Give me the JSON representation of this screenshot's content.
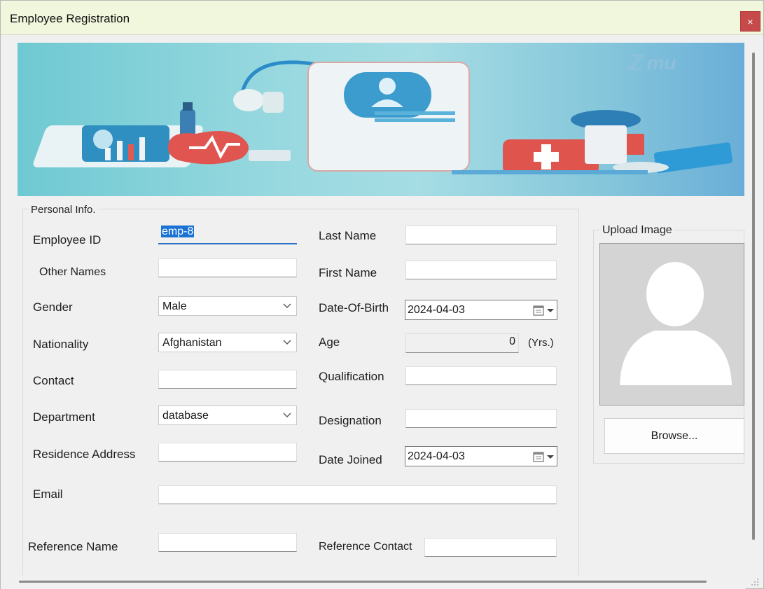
{
  "window": {
    "title": "Employee Registration",
    "close_label": "×"
  },
  "personal": {
    "group_label": "Personal Info.",
    "employee_id_label": "Employee ID",
    "employee_id_value": "emp-8",
    "other_names_label": "Other Names",
    "gender_label": "Gender",
    "gender_value": "Male",
    "nationality_label": "Nationality",
    "nationality_value": "Afghanistan",
    "contact_label": "Contact",
    "department_label": "Department",
    "department_value": "database",
    "residence_label": "Residence Address",
    "email_label": "Email",
    "reference_name_label": "Reference Name",
    "last_name_label": "Last Name",
    "first_name_label": "First Name",
    "dob_label": "Date-Of-Birth",
    "dob_value": "2024-04-03",
    "age_label": "Age",
    "age_value": "0",
    "age_unit": "(Yrs.)",
    "qualification_label": "Qualification",
    "designation_label": "Designation",
    "date_joined_label": "Date Joined",
    "date_joined_value": "2024-04-03",
    "reference_contact_label": "Reference Contact"
  },
  "upload": {
    "group_label": "Upload Image",
    "browse_label": "Browse..."
  },
  "colors": {
    "titlebar": "#f1f7dc",
    "close": "#c64a4a",
    "selection": "#1a73d4",
    "banner": "#8fd2dc"
  },
  "icons": [
    "close-icon",
    "chevron-down-icon",
    "calendar-icon",
    "person-silhouette-icon",
    "resize-grip-icon"
  ]
}
